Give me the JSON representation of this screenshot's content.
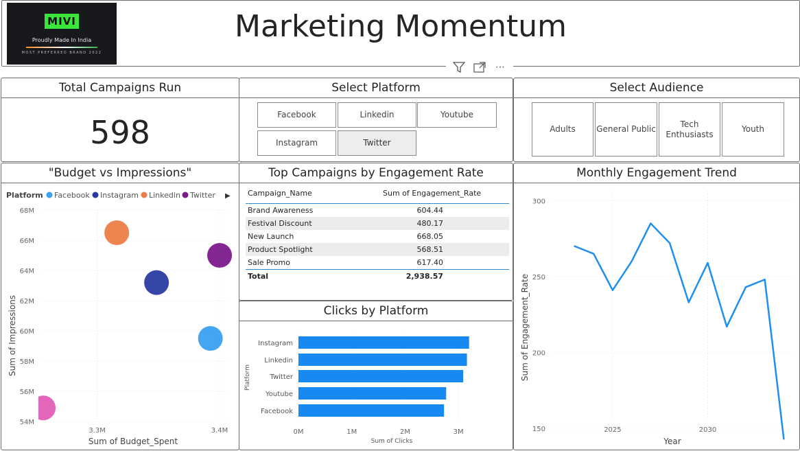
{
  "header": {
    "title": "Marketing Momentum",
    "logo": {
      "mark": "MIVI",
      "tagline": "Proudly Made In India",
      "brand_line": "MOST PREFERRED BRAND 2022"
    },
    "tools": {
      "filter_icon": "filter-icon",
      "focus_icon": "focus-mode-icon",
      "more_icon": "more-options-icon",
      "more_glyph": "⋯",
      "filter_glyph": "▽"
    }
  },
  "kpi": {
    "title": "Total Campaigns Run",
    "value": "598"
  },
  "platform_slicer": {
    "title": "Select Platform",
    "options": [
      "Facebook",
      "Linkedin",
      "Youtube",
      "Instagram",
      "Twitter"
    ],
    "selected": "Twitter"
  },
  "audience_slicer": {
    "title": "Select Audience",
    "options": [
      "Adults",
      "General Public",
      "Tech Enthusiasts",
      "Youth"
    ]
  },
  "top_campaigns": {
    "title": "Top Campaigns by Engagement Rate",
    "headers": [
      "Campaign_Name",
      "Sum of Engagement_Rate"
    ],
    "rows": [
      [
        "Brand Awareness",
        "604.44"
      ],
      [
        "Festival Discount",
        "480.17"
      ],
      [
        "New Launch",
        "668.05"
      ],
      [
        "Product Spotlight",
        "568.51"
      ],
      [
        "Sale Promo",
        "617.40"
      ]
    ],
    "total": [
      "Total",
      "2,938.57"
    ]
  },
  "colors": {
    "facebook": "#3aa0f2",
    "instagram": "#2b3ba3",
    "linkedin": "#ed7d47",
    "twitter": "#7c1a8c",
    "pink": "#e35db8",
    "line": "#1f8fef",
    "bar": "#168af2"
  },
  "chart_data": [
    {
      "type": "scatter",
      "title": "\"Budget vs Impressions\"",
      "xlabel": "Sum of Budget_Spent",
      "ylabel": "Sum of Impressions",
      "legend_title": "Platform",
      "legend": [
        "Facebook",
        "Instagram",
        "Linkedin",
        "Twitter"
      ],
      "legend_more_glyph": "▶",
      "x_ticks": [
        "3.3M",
        "3.4M"
      ],
      "y_ticks": [
        "54M",
        "56M",
        "58M",
        "60M",
        "62M",
        "64M",
        "66M",
        "68M"
      ],
      "xlim": [
        3.2554,
        3.4067
      ],
      "ylim": [
        54,
        68
      ],
      "points": [
        {
          "series": "Linkedin",
          "x": 3.316,
          "y": 66.5,
          "color": "#ed7d47"
        },
        {
          "series": "Instagram",
          "x": 3.3485,
          "y": 63.2,
          "color": "#2b3ba3"
        },
        {
          "series": "Twitter",
          "x": 3.4,
          "y": 65.0,
          "color": "#7c1a8c"
        },
        {
          "series": "Facebook",
          "x": 3.3925,
          "y": 59.5,
          "color": "#3aa0f2"
        },
        {
          "series": "",
          "x": 3.256,
          "y": 54.9,
          "color": "#e35db8"
        }
      ]
    },
    {
      "type": "bar",
      "title": "Clicks by Platform",
      "xlabel": "Sum of Clicks",
      "ylabel": "Platform",
      "categories": [
        "Instagram",
        "Linkedin",
        "Twitter",
        "Youtube",
        "Facebook"
      ],
      "values": [
        3.2,
        3.16,
        3.09,
        2.77,
        2.73
      ],
      "x_ticks": [
        "0M",
        "1M",
        "2M",
        "3M"
      ],
      "xlim": [
        0,
        3.5
      ]
    },
    {
      "type": "line",
      "title": "Monthly Engagement Trend",
      "xlabel": "Year",
      "ylabel": "Sum of Engagement_Rate",
      "x_ticks": [
        "2025",
        "2030"
      ],
      "y_ticks": [
        "150",
        "200",
        "250",
        "300"
      ],
      "xlim": [
        2021.9,
        2034.6
      ],
      "ylim": [
        145,
        306
      ],
      "x": [
        2023,
        2024,
        2025,
        2026,
        2027,
        2028,
        2029,
        2030,
        2031,
        2032,
        2033,
        2034
      ],
      "y": [
        270,
        265,
        241,
        260,
        285,
        272,
        233,
        259,
        217,
        243,
        248,
        143
      ]
    }
  ]
}
